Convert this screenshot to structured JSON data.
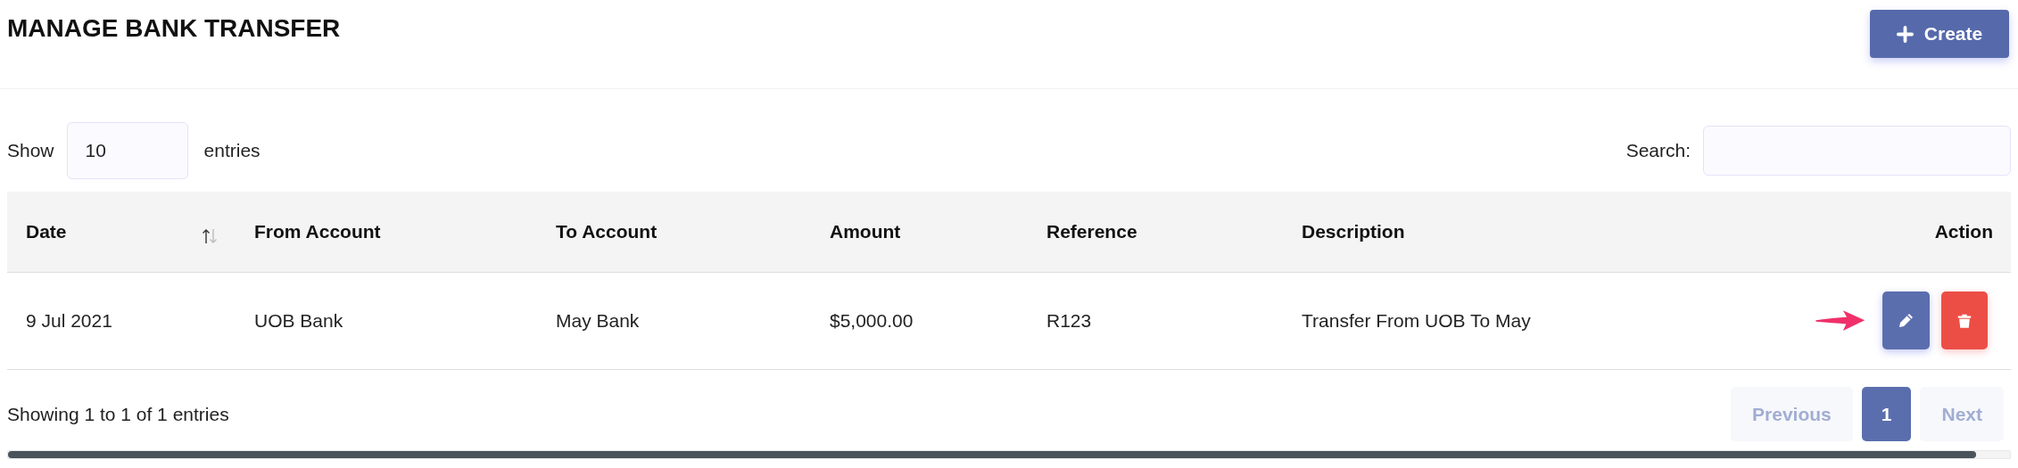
{
  "page": {
    "title": "MANAGE BANK TRANSFER",
    "create_button": "Create"
  },
  "length": {
    "label_before": "Show",
    "value": "10",
    "label_after": "entries"
  },
  "search": {
    "label": "Search:"
  },
  "table": {
    "columns": [
      {
        "label": "Date",
        "sortable": true
      },
      {
        "label": "From Account",
        "sortable": false
      },
      {
        "label": "To Account",
        "sortable": false
      },
      {
        "label": "Amount",
        "sortable": false
      },
      {
        "label": "Reference",
        "sortable": false
      },
      {
        "label": "Description",
        "sortable": false
      },
      {
        "label": "Action",
        "sortable": false
      }
    ],
    "rows": [
      {
        "cells": [
          "9 Jul 2021",
          "UOB Bank",
          "May Bank",
          "$5,000.00",
          "R123",
          "Transfer From UOB To May"
        ]
      }
    ]
  },
  "info": "Showing 1 to 1 of 1 entries",
  "pagination": [
    {
      "label": "Previous",
      "selected": false,
      "disabled": true
    },
    {
      "label": "1",
      "selected": true,
      "disabled": false
    },
    {
      "label": "Next",
      "selected": false,
      "disabled": true
    }
  ]
}
